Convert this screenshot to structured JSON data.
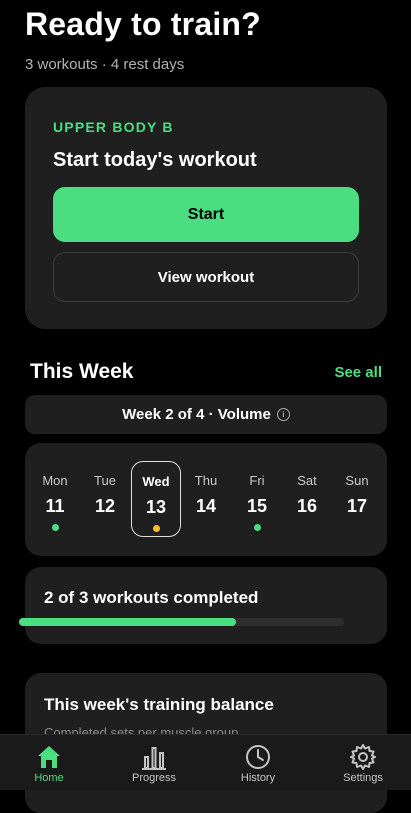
{
  "header": {
    "title": "Ready to train?",
    "subtitle": "3 workouts · 4 rest days"
  },
  "today": {
    "tag": "UPPER BODY B",
    "heading": "Start today's workout",
    "start_label": "Start",
    "view_label": "View workout"
  },
  "week": {
    "section_title": "This Week",
    "see_all": "See all",
    "pill": "Week 2 of 4 · Volume",
    "days": [
      {
        "name": "Mon",
        "num": "11",
        "dot": "green"
      },
      {
        "name": "Tue",
        "num": "12",
        "dot": "none"
      },
      {
        "name": "Wed",
        "num": "13",
        "dot": "yellow",
        "selected": true
      },
      {
        "name": "Thu",
        "num": "14",
        "dot": "none"
      },
      {
        "name": "Fri",
        "num": "15",
        "dot": "green"
      },
      {
        "name": "Sat",
        "num": "16",
        "dot": "none"
      },
      {
        "name": "Sun",
        "num": "17",
        "dot": "none"
      }
    ]
  },
  "progress": {
    "text": "2 of 3 workouts completed",
    "completed": 2,
    "total": 3
  },
  "balance": {
    "title": "This week's training balance",
    "subtitle": "Completed sets per muscle group"
  },
  "nav": {
    "home": "Home",
    "progress": "Progress",
    "history": "History",
    "settings": "Settings",
    "active": "home"
  },
  "colors": {
    "accent": "#4ade80",
    "warning": "#fbbf24",
    "card": "#1f1f1f",
    "background": "#000000"
  }
}
